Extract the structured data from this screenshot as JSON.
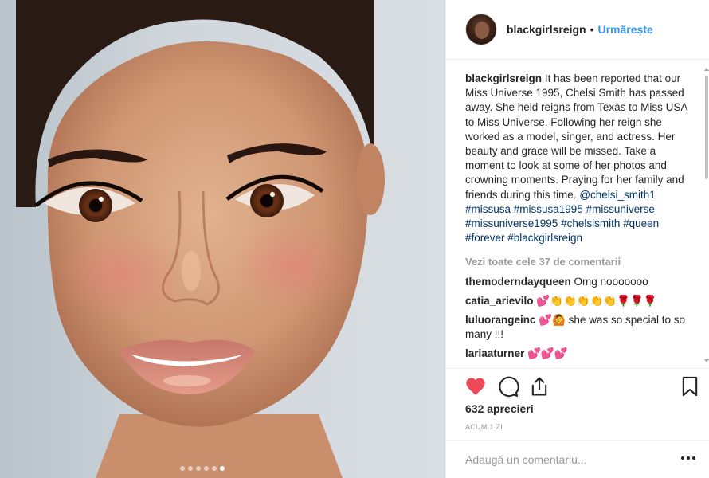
{
  "post": {
    "username": "blackgirlsreign",
    "follow_label": "Urmărește",
    "separator": "•",
    "photo_alt": "portrait photo",
    "carousel_count": 6,
    "carousel_active": 5
  },
  "caption": {
    "username": "blackgirlsreign",
    "text": "It has been reported that our Miss Universe 1995, Chelsi Smith has passed away. She held reigns from Texas to Miss USA to Miss Universe. Following her reign she worked as a model, singer, and actress. Her beauty and grace will be missed. Take a moment to look at some of her photos and crowning moments. Praying for her family and friends during this time.",
    "mention": "@chelsi_smith1",
    "hashtags": "#missusa #missusa1995 #missuniverse #missuniverse1995 #chelsismith #queen #forever #blackgirlsreign"
  },
  "view_all_label": "Vezi toate cele 37 de comentarii",
  "comments": [
    {
      "user": "themoderndayqueen",
      "text": "Omg nooooooo"
    },
    {
      "user": "catia_arievilo",
      "emoji": "💕👏👏👏👏👏🌹🌹🌹",
      "text": ""
    },
    {
      "user": "luluorangeinc",
      "emoji": "💕🙆",
      "text": "she was so special to so many !!!"
    },
    {
      "user": "lariaaturner",
      "emoji": "💕💕💕",
      "text": ""
    }
  ],
  "actions": {
    "like_icon": "heart-icon",
    "comment_icon": "speech-bubble-icon",
    "share_icon": "share-icon",
    "save_icon": "bookmark-icon",
    "like_color": "#ed4956"
  },
  "likes_label": "632 aprecieri",
  "time_label": "ACUM 1 ZI",
  "add_comment": {
    "placeholder": "Adaugă un comentariu...",
    "more_icon": "ellipsis-icon"
  },
  "colors": {
    "link": "#003569",
    "accent": "#3897f0",
    "muted": "#999999",
    "text": "#262626"
  }
}
